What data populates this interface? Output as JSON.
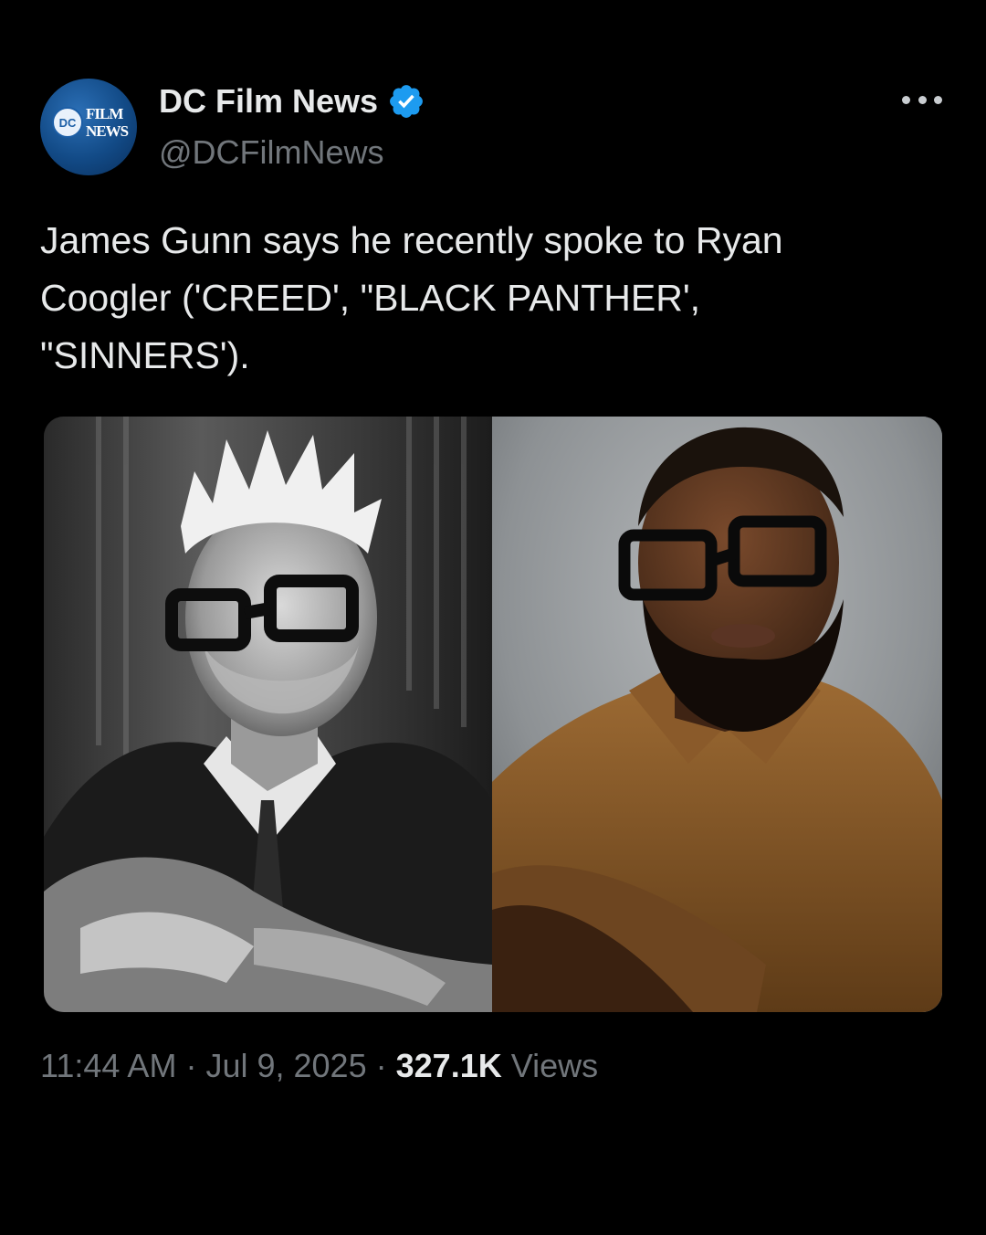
{
  "tweet": {
    "author": {
      "display_name": "DC Film News",
      "handle": "@DCFilmNews",
      "verified": true,
      "avatar_logo_text": [
        "FILM",
        "NEWS"
      ],
      "avatar_badge": "DC"
    },
    "text_lines": [
      "James Gunn says he recently spoke to Ryan",
      "Coogler ('CREED', \"BLACK PANTHER',",
      "\"SINNERS')."
    ],
    "media": [
      {
        "icon": "photo-black-and-white-portrait"
      },
      {
        "icon": "photo-color-portrait"
      }
    ],
    "timestamp": {
      "time": "11:44 AM",
      "separator": "·",
      "date": "Jul 9, 2025",
      "views_count": "327.1K",
      "views_label": "Views"
    }
  },
  "colors": {
    "background": "#000000",
    "primary_text": "#e7e9ea",
    "secondary_text": "#71767b",
    "verified_badge": "#1d9bf0"
  }
}
